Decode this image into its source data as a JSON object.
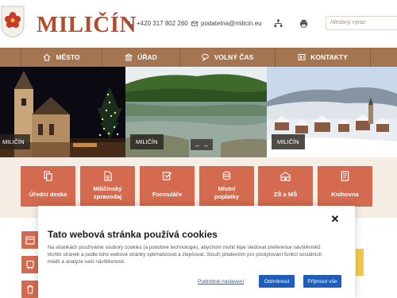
{
  "header": {
    "town_name": "MILIČÍN",
    "phone": "+420 317 802 260",
    "email": "podatelna@milicin.eu",
    "search_placeholder": "Hledaný výraz"
  },
  "nav": {
    "items": [
      {
        "label": "MĚSTO",
        "icon": "home-icon"
      },
      {
        "label": "ÚŘAD",
        "icon": "building-icon"
      },
      {
        "label": "VOLNÝ ČAS",
        "icon": "chat-icon"
      },
      {
        "label": "KONTAKTY",
        "icon": "contacts-icon"
      }
    ]
  },
  "slider": {
    "captions": [
      "MILIČÍN",
      "MILIČÍN",
      "MILIČÍN"
    ],
    "arrows": "← →"
  },
  "tiles": [
    {
      "label_1": "Úřední deska",
      "label_2": "",
      "icon": "document-icon"
    },
    {
      "label_1": "Miličínský",
      "label_2": "zpravodaj",
      "icon": "newspaper-icon"
    },
    {
      "label_1": "Formuláře",
      "label_2": "",
      "icon": "form-icon"
    },
    {
      "label_1": "Místní",
      "label_2": "poplatky",
      "icon": "coins-icon"
    },
    {
      "label_1": "ZŠ a MŠ",
      "label_2": "",
      "icon": "school-icon"
    },
    {
      "label_1": "Knihovna",
      "label_2": "",
      "icon": "book-icon"
    }
  ],
  "cookie": {
    "close": "✕",
    "title": "Tato webová stránka používá cookies",
    "text_1": "Na stránkách používáme soubory cookies (a podobné technologie), abychom mohli lépe sledovat preference návštěvníků",
    "text_2": "těchto stránek a podle toho webové stránky optimalizovat a zlepšovat. Slouží především pro poskytování funkcí sociálních",
    "text_3": "médií a analýze naší návštěvnosti.",
    "settings_link": "Podrobné nastavení",
    "reject_label": "Odmítnout",
    "accept_label": "Přijmout vše"
  },
  "colors": {
    "brand": "#b54a2c",
    "nav": "#a57451",
    "tile": "#d46a50",
    "button": "#1f5dbb"
  }
}
